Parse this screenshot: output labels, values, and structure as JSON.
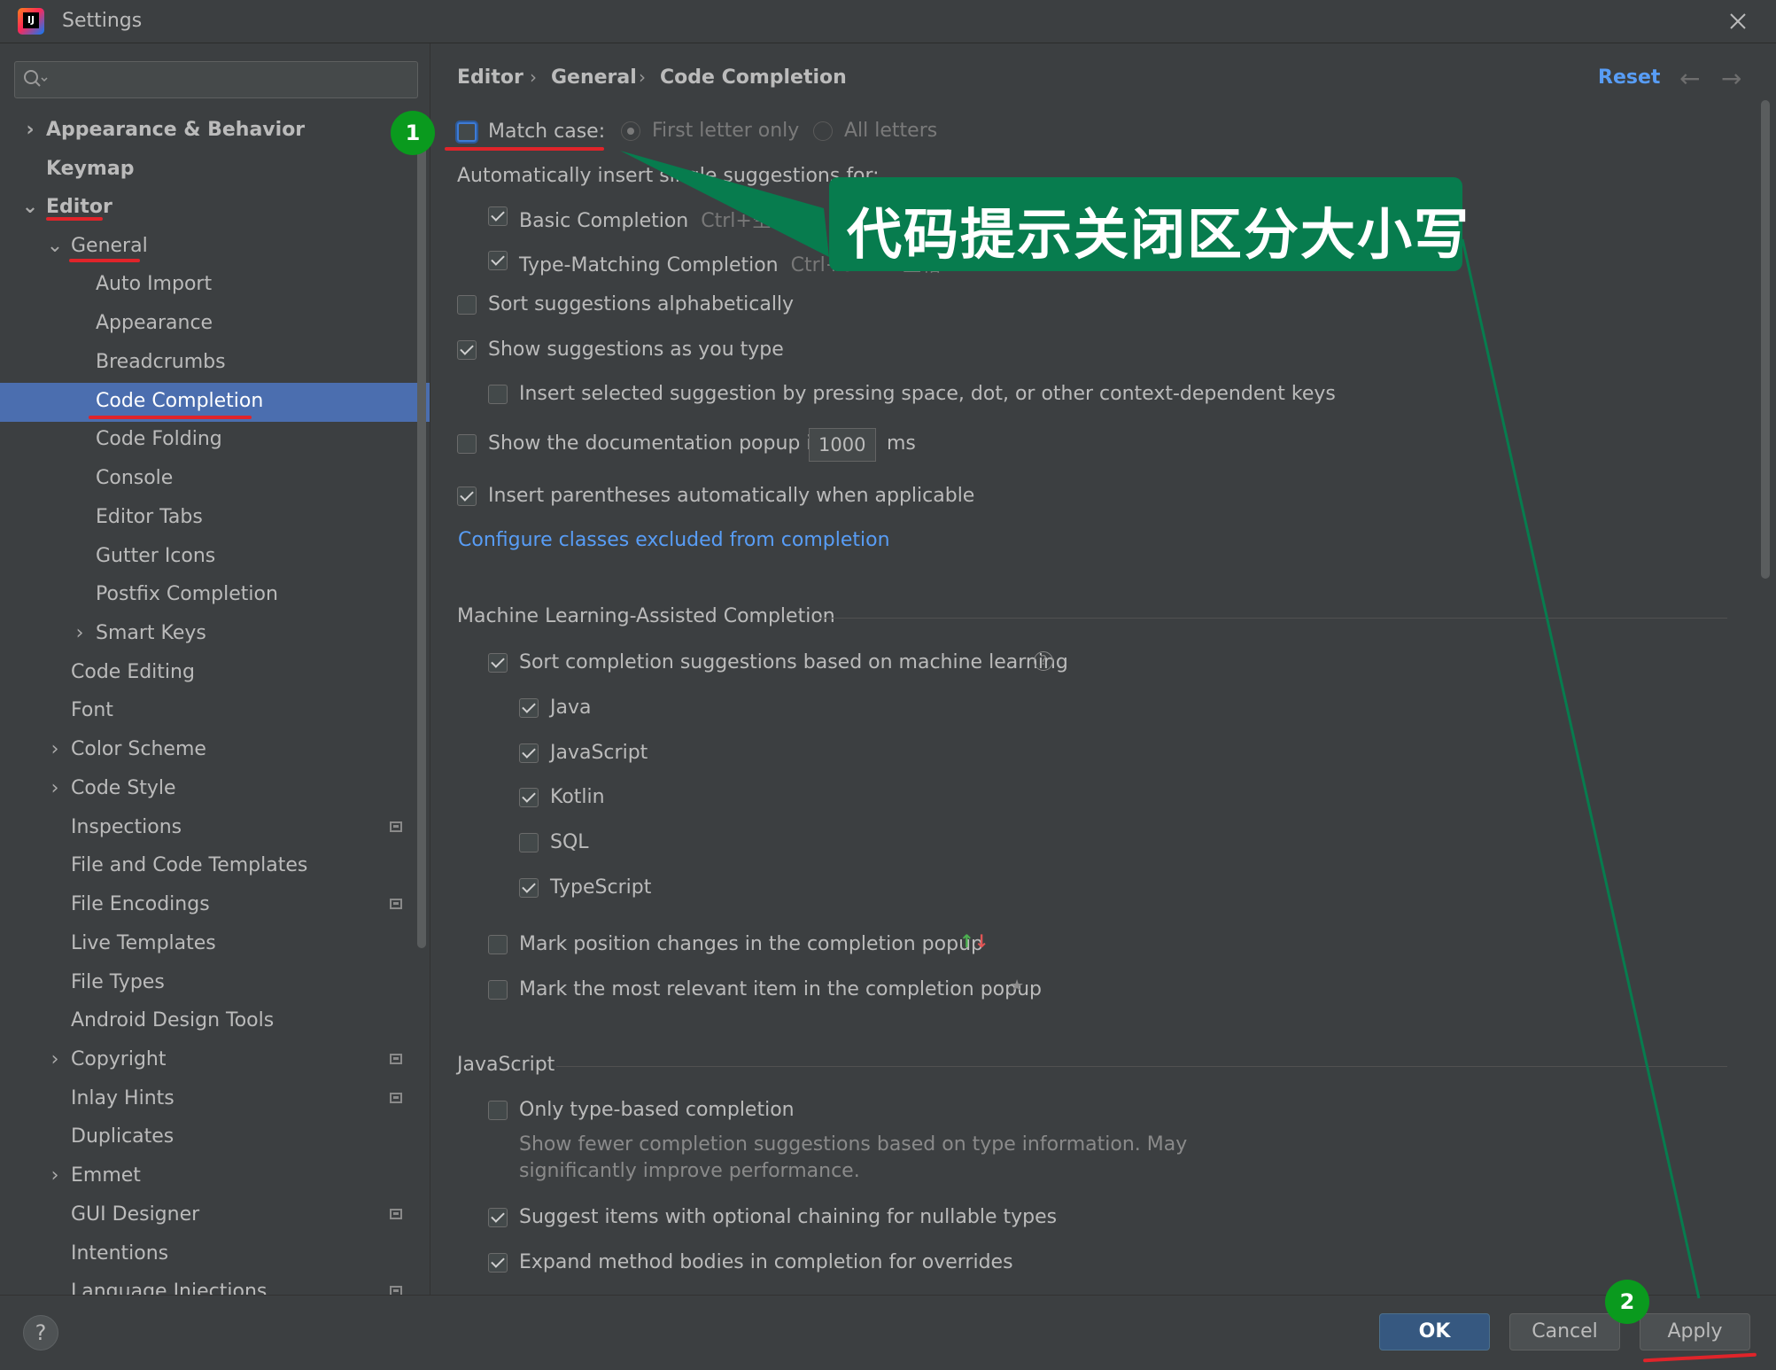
{
  "window": {
    "title": "Settings",
    "logo_text": "IJ"
  },
  "search": {
    "value": "",
    "placeholder": ""
  },
  "sidebar": {
    "items": [
      {
        "label": "Appearance & Behavior",
        "bold": true
      },
      {
        "label": "Keymap",
        "bold": true
      },
      {
        "label": "Editor",
        "bold": true
      },
      {
        "label": "General"
      },
      {
        "label": "Auto Import"
      },
      {
        "label": "Appearance"
      },
      {
        "label": "Breadcrumbs"
      },
      {
        "label": "Code Completion",
        "selected": true
      },
      {
        "label": "Code Folding"
      },
      {
        "label": "Console"
      },
      {
        "label": "Editor Tabs"
      },
      {
        "label": "Gutter Icons"
      },
      {
        "label": "Postfix Completion"
      },
      {
        "label": "Smart Keys"
      },
      {
        "label": "Code Editing"
      },
      {
        "label": "Font"
      },
      {
        "label": "Color Scheme"
      },
      {
        "label": "Code Style"
      },
      {
        "label": "Inspections"
      },
      {
        "label": "File and Code Templates"
      },
      {
        "label": "File Encodings"
      },
      {
        "label": "Live Templates"
      },
      {
        "label": "File Types"
      },
      {
        "label": "Android Design Tools"
      },
      {
        "label": "Copyright"
      },
      {
        "label": "Inlay Hints"
      },
      {
        "label": "Duplicates"
      },
      {
        "label": "Emmet"
      },
      {
        "label": "GUI Designer"
      },
      {
        "label": "Intentions"
      },
      {
        "label": "Language Injections"
      }
    ]
  },
  "breadcrumb": {
    "editor": "Editor",
    "general": "General",
    "page": "Code Completion",
    "separator": "›"
  },
  "header": {
    "reset_label": "Reset",
    "back_icon": "arrow-left-icon",
    "forward_icon": "arrow-right-icon"
  },
  "settings": {
    "match_case": {
      "label": "Match case:",
      "checked": false
    },
    "first_letter_only": "First letter only",
    "all_letters": "All letters",
    "auto_insert_heading": "Automatically insert single suggestions for:",
    "basic_completion": {
      "label": "Basic Completion",
      "shortcut": "Ctrl+空格",
      "checked": true
    },
    "type_matching": {
      "label": "Type-Matching Completion",
      "shortcut": "Ctrl+Shift+空格",
      "checked": true
    },
    "sort_alpha": {
      "label": "Sort suggestions alphabetically",
      "checked": false
    },
    "show_as_type": {
      "label": "Show suggestions as you type",
      "checked": true
    },
    "insert_by_space": {
      "label": "Insert selected suggestion by pressing space, dot, or other context-dependent keys",
      "checked": false
    },
    "doc_popup": {
      "label": "Show the documentation popup in",
      "value": "1000",
      "unit": "ms",
      "checked": false
    },
    "insert_parens": {
      "label": "Insert parentheses automatically when applicable",
      "checked": true
    },
    "configure_link": "Configure classes excluded from completion"
  },
  "ml_section": {
    "title": "Machine Learning-Assisted Completion",
    "sort_ml": {
      "label": "Sort completion suggestions based on machine learning",
      "checked": true
    },
    "languages": [
      {
        "label": "Java",
        "checked": true
      },
      {
        "label": "JavaScript",
        "checked": true
      },
      {
        "label": "Kotlin",
        "checked": true
      },
      {
        "label": "SQL",
        "checked": false
      },
      {
        "label": "TypeScript",
        "checked": true
      }
    ],
    "mark_position": {
      "label": "Mark position changes in the completion popup",
      "checked": false
    },
    "mark_relevant": {
      "label": "Mark the most relevant item in the completion popup",
      "checked": false
    }
  },
  "js_section": {
    "title": "JavaScript",
    "only_type_based": {
      "label": "Only type-based completion",
      "checked": false
    },
    "only_type_based_desc_1": "Show fewer completion suggestions based on type information. May",
    "only_type_based_desc_2": "significantly improve performance.",
    "optional_chaining": {
      "label": "Suggest items with optional chaining for nullable types",
      "checked": true
    },
    "expand_method": {
      "label": "Expand method bodies in completion for overrides",
      "checked": true
    }
  },
  "footer": {
    "help_label": "?",
    "ok_label": "OK",
    "cancel_label": "Cancel",
    "apply_label": "Apply"
  },
  "annotations": {
    "step1": "1",
    "step2": "2",
    "callout": "代码提示关闭区分大小写",
    "colors": {
      "badge": "#0a9a1e",
      "callout": "#077c4e",
      "underline": "#e0242a"
    }
  }
}
